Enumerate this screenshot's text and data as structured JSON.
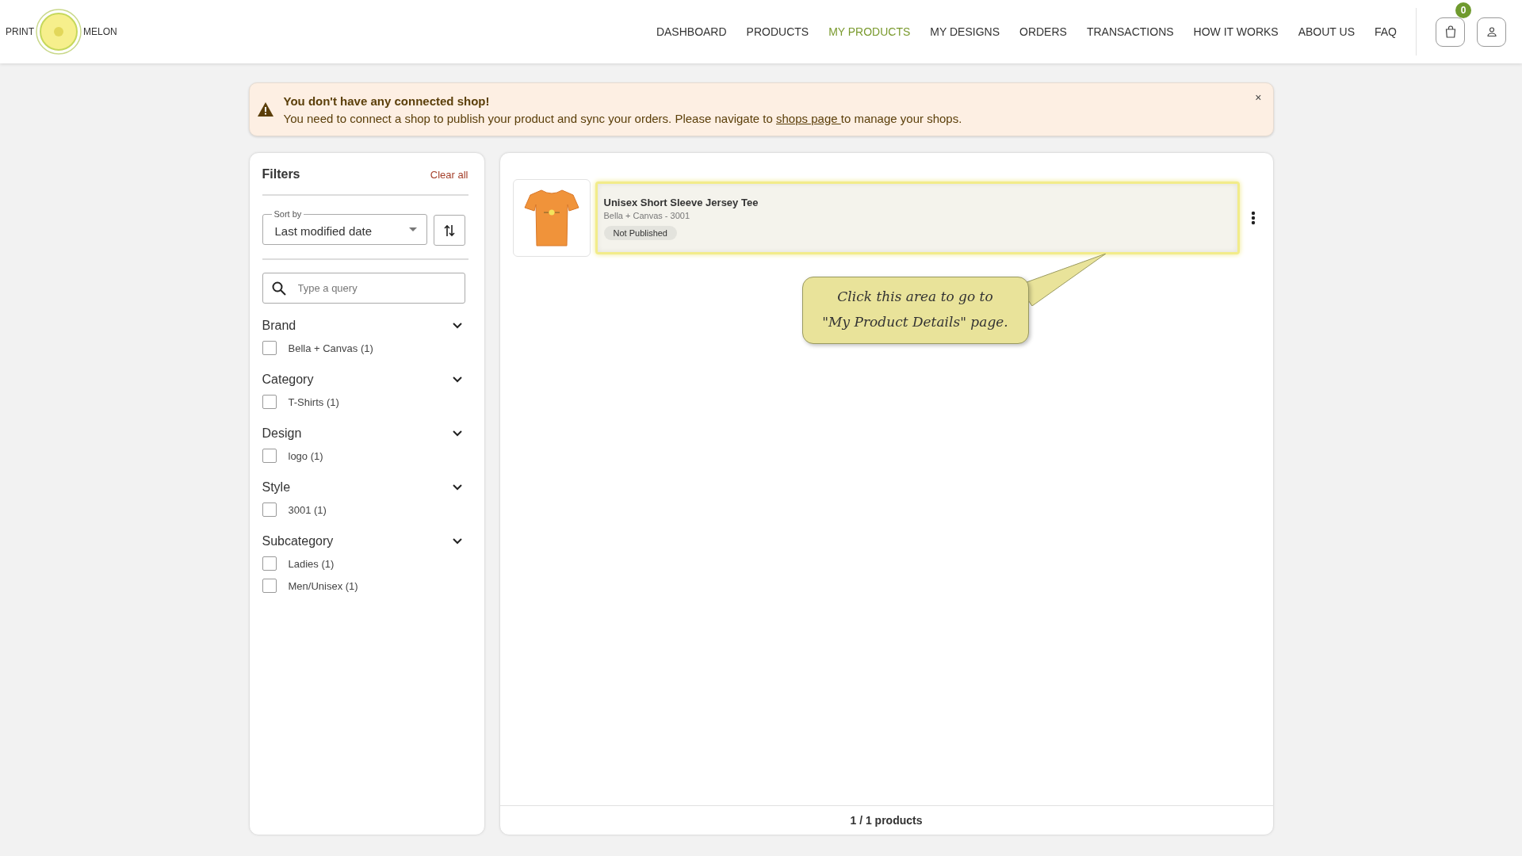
{
  "header": {
    "logo": {
      "left": "PRINT",
      "right": "MELON"
    },
    "nav": [
      {
        "label": "DASHBOARD",
        "selected": false
      },
      {
        "label": "PRODUCTS",
        "selected": false
      },
      {
        "label": "MY PRODUCTS",
        "selected": true
      },
      {
        "label": "MY DESIGNS",
        "selected": false
      },
      {
        "label": "ORDERS",
        "selected": false
      },
      {
        "label": "TRANSACTIONS",
        "selected": false
      },
      {
        "label": "HOW IT WORKS",
        "selected": false
      },
      {
        "label": "ABOUT US",
        "selected": false
      },
      {
        "label": "FAQ",
        "selected": false
      }
    ],
    "cart": {
      "count": "0"
    }
  },
  "alert": {
    "title": "You don't have any connected shop!",
    "message_before": "You need to connect a shop to publish your product and sync your orders. Please navigate to ",
    "link": "shops page ",
    "message_after": "to manage your shops.",
    "close": "×"
  },
  "filters": {
    "title": "Filters",
    "clear_all": "Clear all",
    "sort": {
      "label": "Sort by",
      "value": "Last modified date"
    },
    "search": {
      "placeholder": "Type a query"
    },
    "groups": [
      {
        "title": "Brand",
        "expanded": true,
        "options": [
          {
            "label": "Bella + Canvas (1)",
            "checked": false
          }
        ]
      },
      {
        "title": "Category",
        "expanded": true,
        "options": [
          {
            "label": "T-Shirts (1)",
            "checked": false
          }
        ]
      },
      {
        "title": "Design",
        "expanded": true,
        "options": [
          {
            "label": "logo (1)",
            "checked": false
          }
        ]
      },
      {
        "title": "Style",
        "expanded": true,
        "options": [
          {
            "label": "3001 (1)",
            "checked": false
          }
        ]
      },
      {
        "title": "Subcategory",
        "expanded": true,
        "options": [
          {
            "label": "Ladies (1)",
            "checked": false
          },
          {
            "label": "Men/Unisex (1)",
            "checked": false
          }
        ]
      }
    ]
  },
  "products": {
    "items": [
      {
        "title": "Unisex Short Sleeve Jersey Tee",
        "subtitle": "Bella + Canvas - 3001",
        "status": "Not Published",
        "highlighted": true
      }
    ],
    "callout": "Click this area to go to\n\"My Product Details\" page.",
    "footer": "1 / 1 products"
  }
}
